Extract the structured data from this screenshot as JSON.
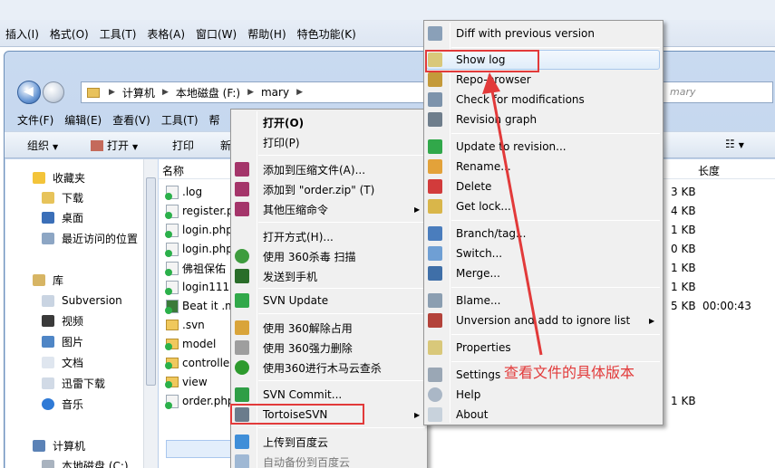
{
  "background_app": {
    "menus": [
      "插入(I)",
      "格式(O)",
      "工具(T)",
      "表格(A)",
      "窗口(W)",
      "帮助(H)",
      "特色功能(K)"
    ]
  },
  "explorer": {
    "breadcrumb": [
      "计算机",
      "本地磁盘 (F:)",
      "mary"
    ],
    "search_placeholder": "mary",
    "menu": [
      "文件(F)",
      "编辑(E)",
      "查看(V)",
      "工具(T)",
      "帮"
    ],
    "toolbar": {
      "organize": "组织",
      "open": "打开",
      "print": "打印",
      "new": "新"
    },
    "nav": {
      "favorites": "收藏夹",
      "downloads": "下载",
      "desktop": "桌面",
      "recent": "最近访问的位置",
      "libraries": "库",
      "subversion": "Subversion",
      "videos": "视频",
      "pictures": "图片",
      "documents": "文档",
      "thunder": "迅雷下载",
      "music": "音乐",
      "computer": "计算机",
      "localdisk": "本地磁盘 (C:)"
    },
    "columns": {
      "name": "名称",
      "length": "长度"
    },
    "files": [
      {
        "name": ".log",
        "size": "3 KB",
        "length": ""
      },
      {
        "name": "register.p",
        "size": "4 KB",
        "length": ""
      },
      {
        "name": "login.php",
        "size": "1 KB",
        "length": ""
      },
      {
        "name": "login.php",
        "size": "0 KB",
        "length": ""
      },
      {
        "name": "佛祖保佑 ,",
        "size": "1 KB",
        "length": ""
      },
      {
        "name": "login111.p",
        "size": "1 KB",
        "length": ""
      },
      {
        "name": "Beat it .m",
        "size": "5 KB",
        "length": "00:00:43"
      },
      {
        "name": ".svn",
        "size": "",
        "length": ""
      },
      {
        "name": "model",
        "size": "",
        "length": ""
      },
      {
        "name": "controller",
        "size": "",
        "length": ""
      },
      {
        "name": "view",
        "size": "",
        "length": ""
      },
      {
        "name": "order.php",
        "size": "1 KB",
        "length": ""
      }
    ]
  },
  "context_menu": {
    "items": [
      "打开(O)",
      "打印(P)",
      "添加到压缩文件(A)...",
      "添加到 \"order.zip\" (T)",
      "其他压缩命令",
      "打开方式(H)...",
      "使用 360杀毒 扫描",
      "发送到手机",
      "SVN Update",
      "使用 360解除占用",
      "使用 360强力删除",
      "使用360进行木马云查杀",
      "SVN Commit...",
      "TortoiseSVN",
      "上传到百度云",
      "自动备份到百度云"
    ]
  },
  "svn_menu": {
    "items": [
      "Diff with previous version",
      "Show log",
      "Repo-browser",
      "Check for modifications",
      "Revision graph",
      "Update to revision...",
      "Rename...",
      "Delete",
      "Get lock...",
      "Branch/tag...",
      "Switch...",
      "Merge...",
      "Blame...",
      "Unversion and add to ignore list",
      "Properties",
      "Settings",
      "Help",
      "About"
    ]
  },
  "annotation": {
    "text": "查看文件的具体版本",
    "color": "#e23a3a"
  }
}
